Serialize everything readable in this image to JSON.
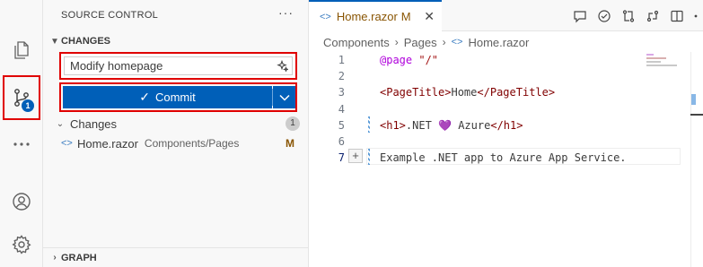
{
  "activity_bar": {
    "items": [
      {
        "name": "explorer",
        "icon": "files-icon"
      },
      {
        "name": "source-control",
        "icon": "source-control-icon",
        "badge": "1"
      },
      {
        "name": "more",
        "icon": "ellipsis-icon"
      },
      {
        "name": "accounts",
        "icon": "account-icon"
      },
      {
        "name": "manage",
        "icon": "gear-icon"
      }
    ]
  },
  "sidebar": {
    "title": "SOURCE CONTROL",
    "more": "···",
    "section_title": "CHANGES",
    "commit_message": "Modify homepage",
    "commit_label": "Commit",
    "changes_group": {
      "label": "Changes",
      "count": "1"
    },
    "files": [
      {
        "name": "Home.razor",
        "path": "Components/Pages",
        "status": "M"
      }
    ],
    "graph_title": "GRAPH"
  },
  "editor": {
    "tab": {
      "name": "Home.razor",
      "status": "M",
      "close": "✕"
    },
    "breadcrumb": {
      "segments": [
        "Components",
        "Pages"
      ],
      "file": "Home.razor"
    },
    "lines": [
      {
        "n": "1",
        "parts": [
          {
            "t": "@page",
            "c": "kw"
          },
          {
            "t": " ",
            "c": "txt"
          },
          {
            "t": "\"/\"",
            "c": "str"
          }
        ]
      },
      {
        "n": "2",
        "parts": []
      },
      {
        "n": "3",
        "parts": [
          {
            "t": "<PageTitle>",
            "c": "tag"
          },
          {
            "t": "Home",
            "c": "txt"
          },
          {
            "t": "</PageTitle>",
            "c": "tag"
          }
        ]
      },
      {
        "n": "4",
        "parts": []
      },
      {
        "n": "5",
        "parts": [
          {
            "t": "<h1>",
            "c": "tag"
          },
          {
            "t": ".NET ",
            "c": "txt"
          },
          {
            "t": "💜",
            "c": "heart"
          },
          {
            "t": " Azure",
            "c": "txt"
          },
          {
            "t": "</h1>",
            "c": "tag"
          }
        ]
      },
      {
        "n": "6",
        "parts": []
      },
      {
        "n": "7",
        "parts": [
          {
            "t": "Example .NET app to Azure App Service.",
            "c": "txt"
          }
        ]
      }
    ],
    "active_line": "7"
  },
  "colors": {
    "accent": "#005fb8",
    "highlight_border": "#e00000",
    "modified": "#895503"
  }
}
